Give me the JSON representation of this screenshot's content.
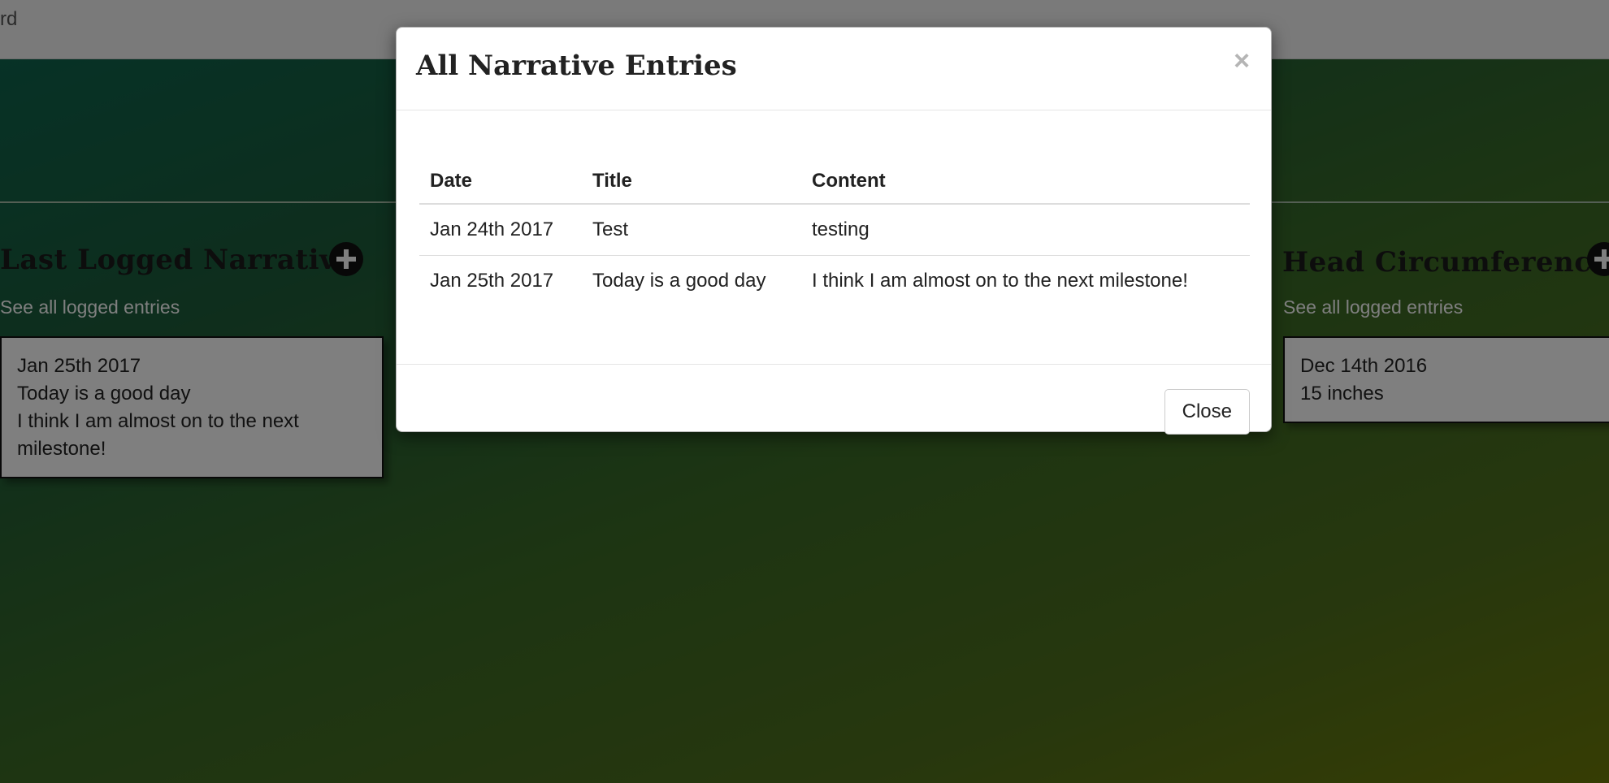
{
  "navbar": {
    "text": "rd"
  },
  "sections": {
    "narrative": {
      "title": "Last Logged Narrative",
      "see_all": "See all logged entries",
      "card": {
        "date": "Jan 25th 2017",
        "title": "Today is a good day",
        "content": "I think I am almost on to the next milestone!"
      }
    },
    "head_circumference": {
      "title": "Head Circumference",
      "see_all": "See all logged entries",
      "card": {
        "date": "Dec 14th 2016",
        "value": "15 inches"
      }
    }
  },
  "modal": {
    "title": "All Narrative Entries",
    "close_x": "×",
    "columns": [
      "Date",
      "Title",
      "Content"
    ],
    "rows": [
      {
        "date": "Jan 24th 2017",
        "title": "Test",
        "content": "testing"
      },
      {
        "date": "Jan 25th 2017",
        "title": "Today is a good day",
        "content": "I think I am almost on to the next milestone!"
      }
    ],
    "close_label": "Close"
  },
  "icons": {
    "add_narrative": "plus-circle-icon",
    "add_head_circumference": "plus-circle-icon"
  }
}
